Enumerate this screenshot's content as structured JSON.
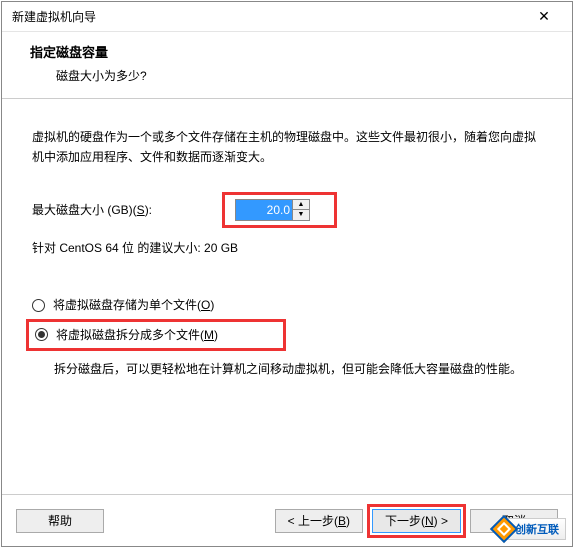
{
  "window": {
    "title": "新建虚拟机向导",
    "close": "✕"
  },
  "header": {
    "title": "指定磁盘容量",
    "subtitle": "磁盘大小为多少?"
  },
  "content": {
    "description": "虚拟机的硬盘作为一个或多个文件存储在主机的物理磁盘中。这些文件最初很小，随着您向虚拟机中添加应用程序、文件和数据而逐渐变大。",
    "disk_size_label": "最大磁盘大小 (GB)(S):",
    "disk_size_value": "20.0",
    "recommend": "针对 CentOS 64 位 的建议大小: 20 GB",
    "radio_single": "将虚拟磁盘存储为单个文件(O)",
    "radio_split": "将虚拟磁盘拆分成多个文件(M)",
    "split_desc": "拆分磁盘后，可以更轻松地在计算机之间移动虚拟机，但可能会降低大容量磁盘的性能。"
  },
  "footer": {
    "help": "帮助",
    "back": "< 上一步(B)",
    "next": "下一步(N) >",
    "cancel": "取消"
  },
  "badge": {
    "text": "创新互联"
  }
}
